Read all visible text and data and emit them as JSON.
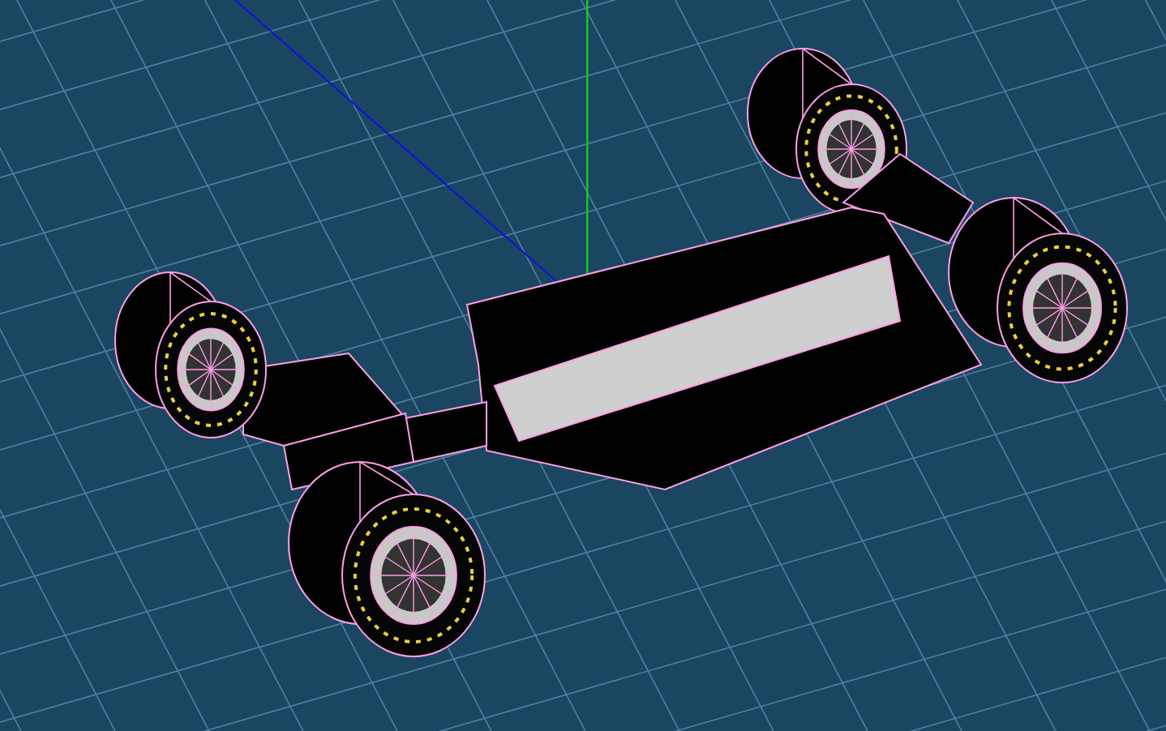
{
  "viewport": {
    "grid": true,
    "wireframe": true,
    "axes": [
      {
        "kind": "x",
        "color": "#1010e0"
      },
      {
        "kind": "y",
        "color": "#10d010"
      }
    ]
  }
}
